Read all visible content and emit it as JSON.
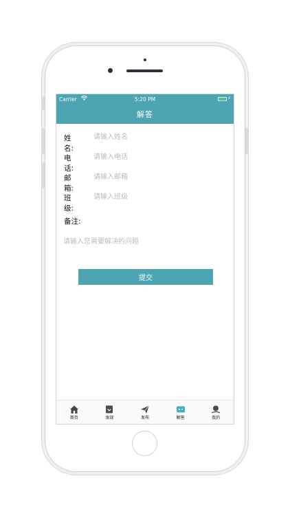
{
  "status_bar": {
    "carrier": "Carrier",
    "time": "5:20 PM"
  },
  "nav": {
    "title": "解答"
  },
  "form": {
    "name_label": "姓名:",
    "name_placeholder": "请输入姓名",
    "phone_label": "电话:",
    "phone_placeholder": "请输入电话",
    "email_label": "邮箱:",
    "email_placeholder": "请输入邮箱",
    "class_label": "班级:",
    "class_placeholder": "请输入班级",
    "remark_label": "备注:",
    "remark_placeholder": "请输入您需要解决的问题",
    "submit_label": "提交"
  },
  "tabbar": {
    "items": [
      {
        "label": "首页",
        "icon": "home-icon"
      },
      {
        "label": "发现",
        "icon": "discover-icon"
      },
      {
        "label": "发布",
        "icon": "send-icon"
      },
      {
        "label": "解答",
        "icon": "chat-icon",
        "active": true
      },
      {
        "label": "我的",
        "icon": "profile-icon"
      }
    ]
  },
  "colors": {
    "accent": "#4da5b3",
    "battery": "#4cd964"
  }
}
